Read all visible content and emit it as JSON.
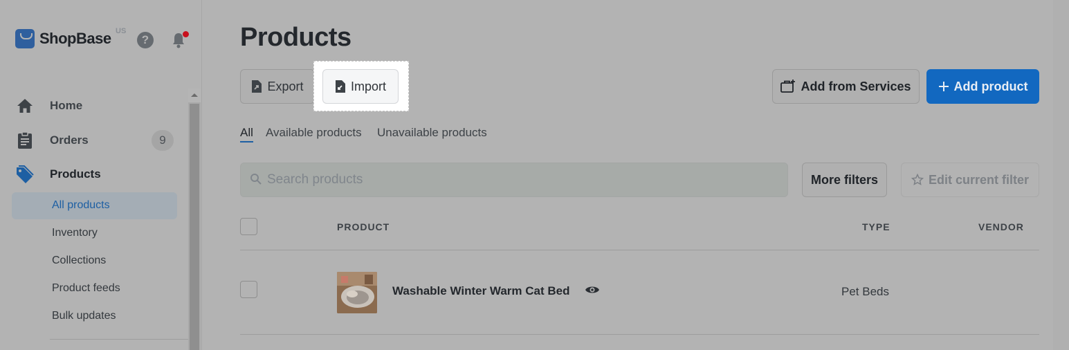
{
  "brand": {
    "name": "ShopBase",
    "region": "US"
  },
  "sidebar": {
    "nav": [
      {
        "label": "Home",
        "icon": "home-icon"
      },
      {
        "label": "Orders",
        "icon": "clipboard-icon",
        "badge": "9"
      },
      {
        "label": "Products",
        "icon": "tag-icon"
      }
    ],
    "sub_items": [
      {
        "label": "All products",
        "active": true
      },
      {
        "label": "Inventory"
      },
      {
        "label": "Collections"
      },
      {
        "label": "Product feeds"
      },
      {
        "label": "Bulk updates"
      }
    ]
  },
  "header": {
    "title": "Products",
    "export_label": "Export",
    "import_label": "Import",
    "services_label": "Add from Services",
    "add_label": "Add product"
  },
  "tabs": [
    "All",
    "Available products",
    "Unavailable products"
  ],
  "search": {
    "placeholder": "Search products"
  },
  "filters": {
    "more_label": "More filters",
    "edit_label": "Edit current filter"
  },
  "table": {
    "columns": [
      "PRODUCT",
      "TYPE",
      "VENDOR"
    ],
    "rows": [
      {
        "name": "Washable Winter Warm Cat Bed",
        "type": "Pet Beds",
        "vendor": ""
      }
    ]
  },
  "colors": {
    "accent": "#1268c0",
    "active_link": "#1d5fa3",
    "notification": "#c8101d"
  }
}
